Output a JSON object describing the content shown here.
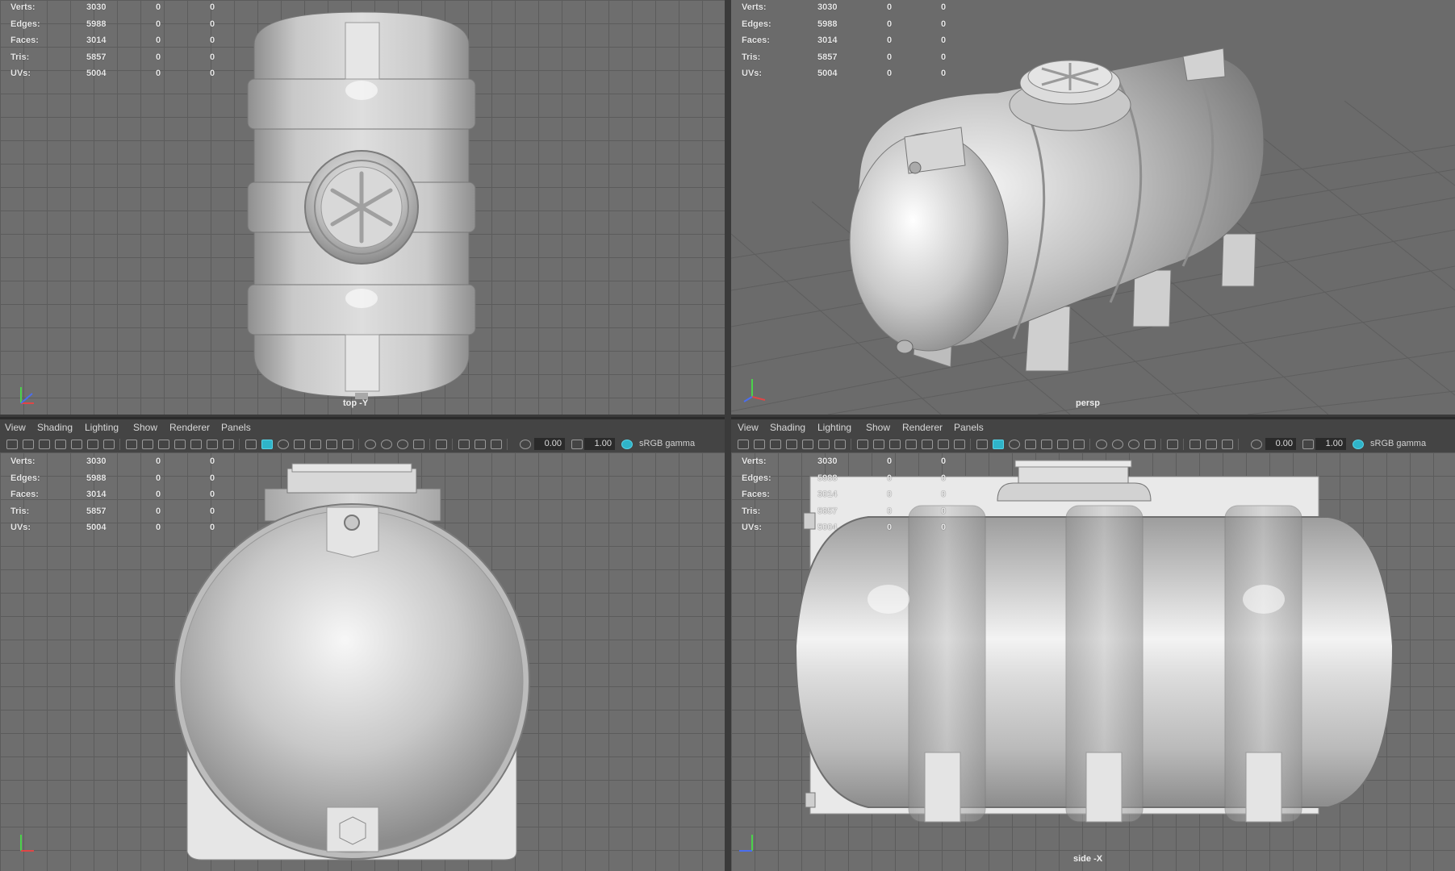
{
  "stats": [
    {
      "label": "Verts:",
      "v1": "3030",
      "v2": "0",
      "v3": "0"
    },
    {
      "label": "Edges:",
      "v1": "5988",
      "v2": "0",
      "v3": "0"
    },
    {
      "label": "Faces:",
      "v1": "3014",
      "v2": "0",
      "v3": "0"
    },
    {
      "label": "Tris:",
      "v1": "5857",
      "v2": "0",
      "v3": "0"
    },
    {
      "label": "UVs:",
      "v1": "5004",
      "v2": "0",
      "v3": "0"
    }
  ],
  "viewports": {
    "top": {
      "camera": "top -Y"
    },
    "persp": {
      "camera": "persp"
    },
    "front": {
      "camera": ""
    },
    "side": {
      "camera": "side -X"
    }
  },
  "menu": {
    "view": "View",
    "shading": "Shading",
    "lighting": "Lighting",
    "show": "Show",
    "renderer": "Renderer",
    "panels": "Panels"
  },
  "toolbar": {
    "exposure": "0.00",
    "gamma": "1.00",
    "color_space": "sRGB gamma"
  },
  "colors": {
    "accent": "#2fb4c9",
    "viewport_bg": "#6e6e6e",
    "grid": "#5c5c5c",
    "model": "#c8c8c8"
  }
}
